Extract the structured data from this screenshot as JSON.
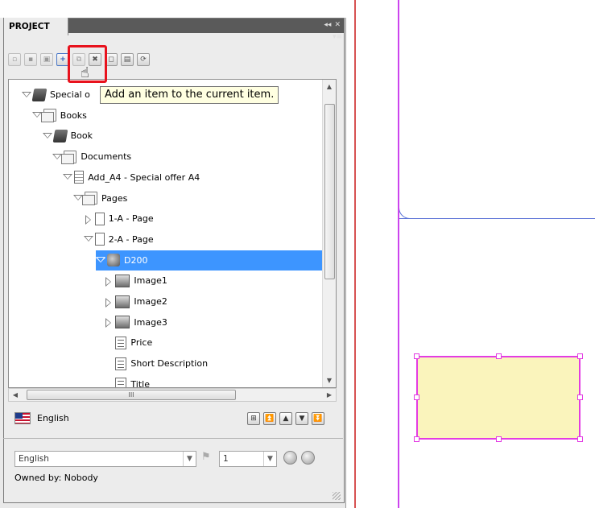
{
  "panel": {
    "tab_label": "PROJECT",
    "top_controls": [
      "◂◂",
      "✕"
    ],
    "menu_icon": "panel-menu-icon"
  },
  "toolbar": {
    "buttons": [
      {
        "name": "open-item-icon",
        "enabled": false
      },
      {
        "name": "save-item-icon",
        "enabled": false
      },
      {
        "name": "save-all-icon",
        "enabled": false
      },
      {
        "name": "add-item-icon",
        "enabled": true
      },
      {
        "name": "duplicate-item-icon",
        "enabled": false
      },
      {
        "name": "delete-item-icon",
        "enabled": true
      },
      {
        "name": "new-page-icon",
        "enabled": true
      },
      {
        "name": "properties-icon",
        "enabled": true
      },
      {
        "name": "refresh-icon",
        "enabled": true
      }
    ],
    "tooltip": "Add an item to the current item."
  },
  "tree": {
    "rows": [
      {
        "label": "Special o",
        "level": 0,
        "icon": "book",
        "twisty": "open"
      },
      {
        "label": "Books",
        "level": 1,
        "icon": "folder",
        "twisty": "open"
      },
      {
        "label": "Book",
        "level": 2,
        "icon": "book",
        "twisty": "open"
      },
      {
        "label": "Documents",
        "level": 3,
        "icon": "folder",
        "twisty": "open"
      },
      {
        "label": "Add_A4 - Special offer A4",
        "level": 4,
        "icon": "doc",
        "twisty": "open"
      },
      {
        "label": "Pages",
        "level": 5,
        "icon": "folder",
        "twisty": "open"
      },
      {
        "label": "1-A - Page",
        "level": 6,
        "icon": "page",
        "twisty": "closed"
      },
      {
        "label": "2-A - Page",
        "level": 6,
        "icon": "page",
        "twisty": "open"
      },
      {
        "label": "D200",
        "level": 7,
        "icon": "group",
        "twisty": "open",
        "selected": true
      },
      {
        "label": "Image1",
        "level": 8,
        "icon": "image",
        "twisty": "closed"
      },
      {
        "label": "Image2",
        "level": 8,
        "icon": "image",
        "twisty": "closed"
      },
      {
        "label": "Image3",
        "level": 8,
        "icon": "image",
        "twisty": "closed"
      },
      {
        "label": "Price",
        "level": 8,
        "icon": "text",
        "twisty": "none"
      },
      {
        "label": "Short Description",
        "level": 8,
        "icon": "text",
        "twisty": "none"
      },
      {
        "label": "Title",
        "level": 8,
        "icon": "text",
        "twisty": "none"
      }
    ],
    "hscroll_thumb_glyph": "III"
  },
  "language": {
    "flag_icon": "us-flag-icon",
    "label": "English",
    "nav_buttons": [
      "expand-tree-icon",
      "move-top-icon",
      "move-up-icon",
      "move-down-icon",
      "move-bottom-icon"
    ]
  },
  "bottom": {
    "language_select_value": "English",
    "version_select_value": "1",
    "owned_by": "Owned by: Nobody"
  },
  "canvas": {
    "accent_frame_color": "#5a72d6",
    "guide_color": "#cc44ee",
    "selected_box_fill": "#faf4bc",
    "selected_box_border": "#e33ce3"
  }
}
